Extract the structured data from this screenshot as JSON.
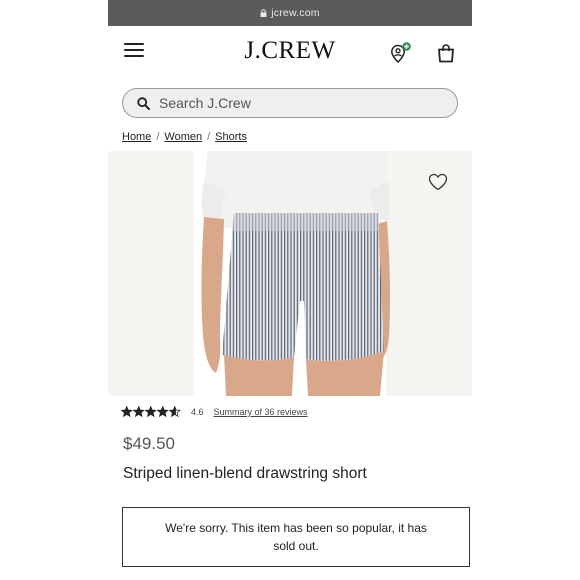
{
  "browser": {
    "url": "jcrew.com",
    "icons": {
      "lock": "lock-icon"
    }
  },
  "header": {
    "logo": "J.CREW",
    "icons": {
      "menu": "hamburger-menu-icon",
      "account": "account-icon",
      "bag": "shopping-bag-icon"
    },
    "colors": {
      "account_badge": "#2e8b4e"
    }
  },
  "search": {
    "placeholder": "Search J.Crew",
    "icon": "search-icon"
  },
  "breadcrumb": {
    "items": [
      "Home",
      "Women",
      "Shorts"
    ],
    "separator": "/"
  },
  "product": {
    "wishlist_icon": "heart-icon",
    "rating_value": "4.6",
    "rating_stars": 4.6,
    "reviews_link": "Summary of 36 reviews",
    "price": "$49.50",
    "name": "Striped linen-blend drawstring short",
    "soldout_message": "We're sorry. This item has been so popular, it has sold out."
  }
}
